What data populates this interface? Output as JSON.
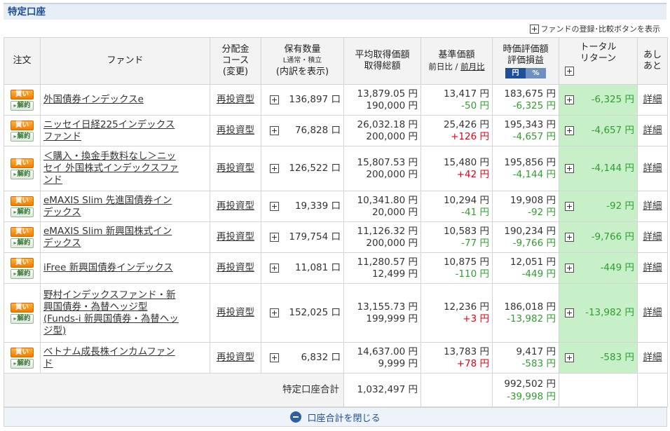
{
  "section": {
    "title": "特定口座"
  },
  "toggle": {
    "label": "ファンドの登録･比較ボタンを表示",
    "icon": "plus-square-icon"
  },
  "headers": {
    "order": "注文",
    "fund": "ファンド",
    "course_l1": "分配金",
    "course_l2": "コース",
    "course_l3": "(変更)",
    "qty_l1": "保有数量",
    "qty_l2": "L通常・積立",
    "qty_l3": "(内訳を表示)",
    "avg_l1": "平均取得価額",
    "avg_l2": "取得総額",
    "nav_l1": "基準価額",
    "nav_l2a": "前日比",
    "nav_sep": " / ",
    "nav_l2b": "前月比",
    "val_l1": "時価評価額",
    "val_l2": "評価損益",
    "val_tab_yen": "円",
    "val_tab_pct": "%",
    "ret_l1": "トータル",
    "ret_l2": "リターン",
    "ashiato_l1": "あし",
    "ashiato_l2": "あと"
  },
  "labels": {
    "buy": "買い",
    "sell": "解約",
    "detail": "詳細"
  },
  "rows": [
    {
      "fund_l1": "外国債券インデックスe",
      "fund_l2": "",
      "fund_l3": "",
      "fund_l4": "",
      "course": "再投資型",
      "qty": "136,897 口",
      "avg_price": "13,879.05 円",
      "acq_total": "190,000 円",
      "nav": "13,417 円",
      "nav_change": "-50 円",
      "value": "183,675 円",
      "pl": "-6,325 円",
      "total_return": "-6,325 円"
    },
    {
      "fund_l1": "ニッセイ日経225インデックス",
      "fund_l2": "ファンド",
      "fund_l3": "",
      "fund_l4": "",
      "course": "再投資型",
      "qty": "76,828 口",
      "avg_price": "26,032.18 円",
      "acq_total": "200,000 円",
      "nav": "25,426 円",
      "nav_change": "+126 円",
      "value": "195,343 円",
      "pl": "-4,657 円",
      "total_return": "-4,657 円"
    },
    {
      "fund_l1": "＜購入・換金手数料なし＞ニッ",
      "fund_l2": "セイ 外国株式インデックスファ",
      "fund_l3": "ンド",
      "fund_l4": "",
      "course": "再投資型",
      "qty": "126,522 口",
      "avg_price": "15,807.53 円",
      "acq_total": "200,000 円",
      "nav": "15,480 円",
      "nav_change": "+42 円",
      "value": "195,856 円",
      "pl": "-4,144 円",
      "total_return": "-4,144 円"
    },
    {
      "fund_l1": "eMAXIS Slim 先進国債券イン",
      "fund_l2": "デックス",
      "fund_l3": "",
      "fund_l4": "",
      "course": "再投資型",
      "qty": "19,339 口",
      "avg_price": "10,341.80 円",
      "acq_total": "20,000 円",
      "nav": "10,294 円",
      "nav_change": "-41 円",
      "value": "19,908 円",
      "pl": "-92 円",
      "total_return": "-92 円"
    },
    {
      "fund_l1": "eMAXIS Slim 新興国株式イン",
      "fund_l2": "デックス",
      "fund_l3": "",
      "fund_l4": "",
      "course": "再投資型",
      "qty": "179,754 口",
      "avg_price": "11,126.32 円",
      "acq_total": "200,000 円",
      "nav": "10,583 円",
      "nav_change": "-77 円",
      "value": "190,234 円",
      "pl": "-9,766 円",
      "total_return": "-9,766 円"
    },
    {
      "fund_l1": "iFree 新興国債券インデックス",
      "fund_l2": "",
      "fund_l3": "",
      "fund_l4": "",
      "course": "再投資型",
      "qty": "11,081 口",
      "avg_price": "11,280.57 円",
      "acq_total": "12,499 円",
      "nav": "10,875 円",
      "nav_change": "-110 円",
      "value": "12,051 円",
      "pl": "-449 円",
      "total_return": "-449 円"
    },
    {
      "fund_l1": "野村インデックスファンド・新",
      "fund_l2": "興国債券・為替ヘッジ型",
      "fund_l3": "(Funds-i 新興国債券・為替ヘッ",
      "fund_l4": "ジ型)",
      "course": "再投資型",
      "qty": "152,025 口",
      "avg_price": "13,155.73 円",
      "acq_total": "199,999 円",
      "nav": "12,236 円",
      "nav_change": "+3 円",
      "value": "186,018 円",
      "pl": "-13,982 円",
      "total_return": "-13,982 円"
    },
    {
      "fund_l1": "ベトナム成長株インカムファン",
      "fund_l2": "ド",
      "fund_l3": "",
      "fund_l4": "",
      "course": "再投資型",
      "qty": "6,832 口",
      "avg_price": "14,637.00 円",
      "acq_total": "9,999 円",
      "nav": "13,783 円",
      "nav_change": "+78 円",
      "value": "9,417 円",
      "pl": "-583 円",
      "total_return": "-583 円"
    }
  ],
  "totals": {
    "label": "特定口座合計",
    "acq_total": "1,032,497 円",
    "value": "992,502 円",
    "pl": "-39,998 円"
  },
  "close_bar": {
    "label": "口座合計を閉じる",
    "icon": "minus-circle-icon"
  },
  "colors": {
    "header_text": "#1d4f91",
    "buy_orange": "#f07c00",
    "gain_red": "#e60012",
    "loss_green": "#2f9e2f",
    "return_bg": "#c8f0c8"
  }
}
